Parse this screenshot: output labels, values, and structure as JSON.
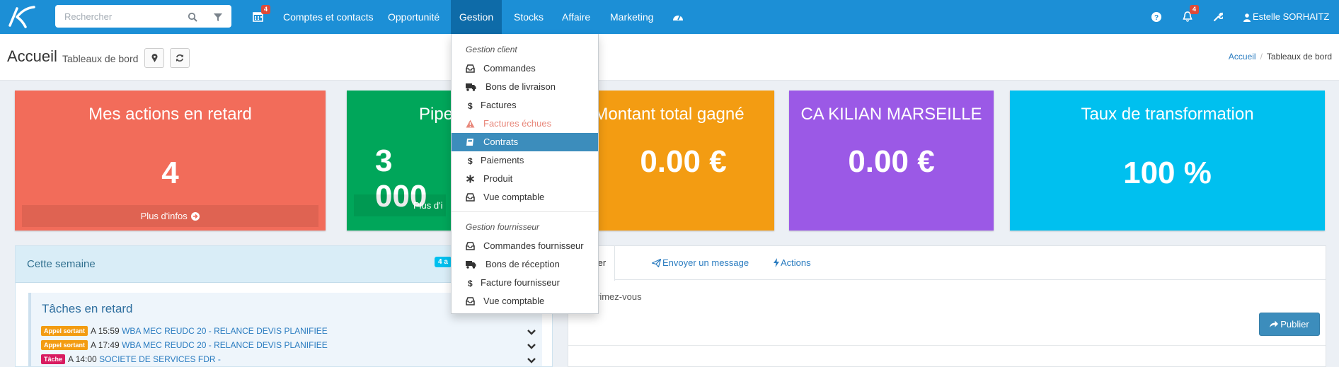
{
  "colors": {
    "navbar": "#1c8fd6",
    "nav_active": "#0e6ba8",
    "box_retard": "#f26c5a",
    "box_pipe": "#00a65a",
    "box_montant": "#f39c12",
    "box_ca": "#9b59e6",
    "box_taux": "#00c0ef",
    "highlight": "#3c8dbc",
    "tag_orange": "#f39c12",
    "tag_magenta": "#d81b60"
  },
  "navbar": {
    "search_placeholder": "Rechercher",
    "calendar_badge": "4",
    "items": [
      "Comptes et contacts",
      "Opportunité",
      "Gestion",
      "Stocks",
      "Affaire",
      "Marketing"
    ],
    "notifications_badge": "4",
    "user_name": "Estelle SORHAITZ",
    "icons": [
      "logo-k",
      "search-icon",
      "filter-icon",
      "calendar-icon",
      "dashboard-icon",
      "help-icon",
      "bell-icon",
      "wrench-icon",
      "user-icon",
      "caret-down-icon"
    ]
  },
  "page_header": {
    "title": "Accueil",
    "subtitle": "Tableaux de bord",
    "breadcrumb": {
      "home": "Accueil",
      "separator": "/",
      "current": "Tableaux de bord"
    }
  },
  "boxes": [
    {
      "title": "Mes actions en retard",
      "value": "4",
      "footer": "Plus d'infos"
    },
    {
      "title": "Pipe",
      "value": "3 000",
      "footer": "Plus d'i"
    },
    {
      "title": "Montant total gagné",
      "value": "0.00 €"
    },
    {
      "title": "CA KILIAN MARSEILLE",
      "value": "0.00 €"
    },
    {
      "title": "Taux de transformation",
      "value": "100 %"
    }
  ],
  "week_panel": {
    "title": "Cette semaine",
    "badge": "4 a",
    "tasks_title": "Tâches en retard",
    "tasks": [
      {
        "tag": "Appel sortant",
        "time": "A 15:59",
        "text": "WBA MEC REUDC 20 - RELANCE DEVIS PLANIFIEE"
      },
      {
        "tag": "Appel sortant",
        "time": "A 17:49",
        "text": "WBA MEC REUDC 20 - RELANCE DEVIS PLANIFIEE"
      },
      {
        "tag": "Tâche",
        "time": "A 14:00",
        "text": "SOCIETE DE SERVICES FDR -"
      }
    ]
  },
  "share_panel": {
    "tabs": [
      "artager",
      "Envoyer un message",
      "Actions"
    ],
    "compose_placeholder": "rimez-vous",
    "publish_label": "Publier"
  },
  "gestion_menu": {
    "client_header": "Gestion client",
    "client_items": [
      {
        "label": "Commandes",
        "icon": "inbox-icon"
      },
      {
        "label": "Bons de livraison",
        "icon": "truck-icon"
      },
      {
        "label": "Factures",
        "icon": "dollar-icon"
      },
      {
        "label": "Factures échues",
        "icon": "warning-icon"
      },
      {
        "label": "Contrats",
        "icon": "book-icon"
      },
      {
        "label": "Paiements",
        "icon": "dollar-icon"
      },
      {
        "label": "Produit",
        "icon": "asterisk-icon"
      },
      {
        "label": "Vue comptable",
        "icon": "inbox-icon"
      }
    ],
    "supplier_header": "Gestion fournisseur",
    "supplier_items": [
      {
        "label": "Commandes fournisseur",
        "icon": "inbox-icon"
      },
      {
        "label": "Bons de réception",
        "icon": "truck-icon"
      },
      {
        "label": "Facture fournisseur",
        "icon": "dollar-icon"
      },
      {
        "label": "Vue comptable",
        "icon": "inbox-icon"
      }
    ]
  }
}
